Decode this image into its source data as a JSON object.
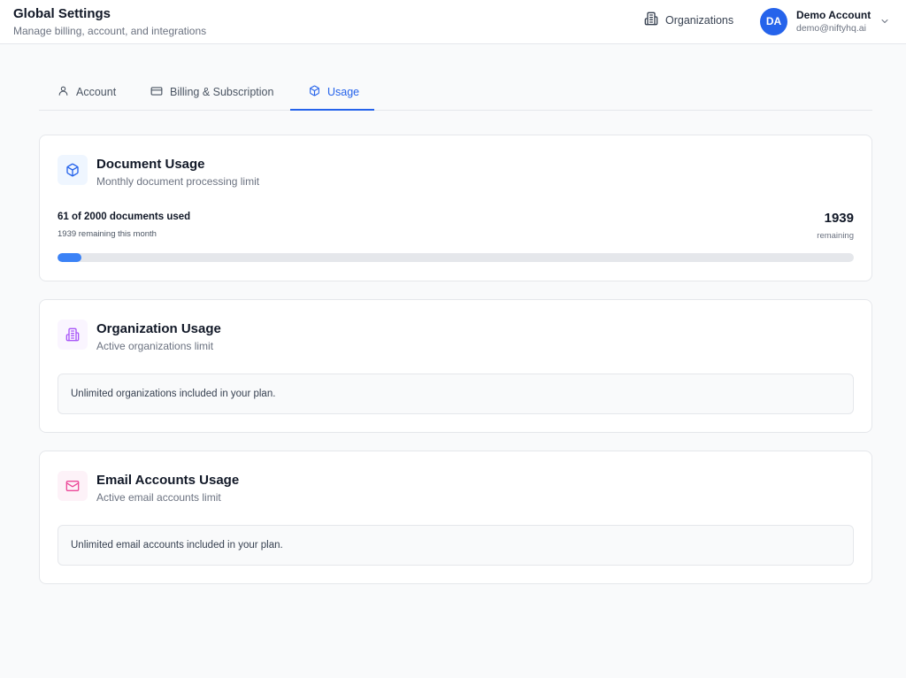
{
  "header": {
    "title": "Global Settings",
    "subtitle": "Manage billing, account, and integrations",
    "organizations_label": "Organizations",
    "user": {
      "initials": "DA",
      "name": "Demo Account",
      "email": "demo@niftyhq.ai"
    }
  },
  "tabs": [
    {
      "label": "Account",
      "icon": "user-icon",
      "active": false
    },
    {
      "label": "Billing & Subscription",
      "icon": "credit-card-icon",
      "active": false
    },
    {
      "label": "Usage",
      "icon": "box-icon",
      "active": true
    }
  ],
  "document_usage": {
    "title": "Document Usage",
    "description": "Monthly document processing limit",
    "used_text": "61 of 2000 documents used",
    "remaining_text": "1939 remaining this month",
    "remaining_count": "1939",
    "remaining_label": "remaining",
    "used": 61,
    "limit": 2000,
    "icon": "box-icon"
  },
  "organization_usage": {
    "title": "Organization Usage",
    "description": "Active organizations limit",
    "notice": "Unlimited organizations included in your plan.",
    "icon": "building-icon"
  },
  "email_usage": {
    "title": "Email Accounts Usage",
    "description": "Active email accounts limit",
    "notice": "Unlimited email accounts included in your plan.",
    "icon": "mail-icon"
  },
  "colors": {
    "accent": "#2563eb",
    "progress": "#3b82f6",
    "document_icon_bg": "#eff6ff",
    "organization_icon": "#a855f7",
    "organization_icon_bg": "#faf5ff",
    "email_icon": "#ec4899",
    "email_icon_bg": "#fdf2f8"
  }
}
